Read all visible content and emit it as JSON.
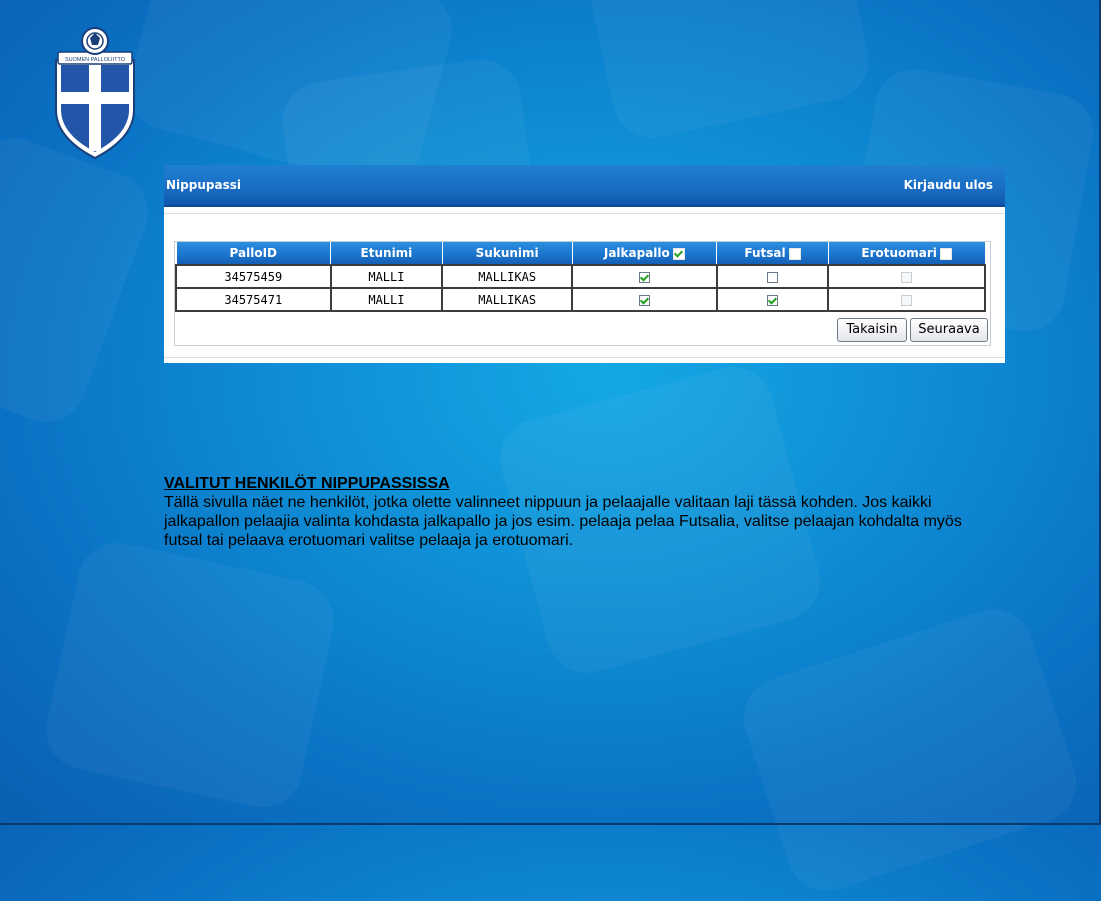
{
  "header": {
    "title": "Nippupassi",
    "logout_label": "Kirjaudu ulos"
  },
  "logo": {
    "name": "suomen-palloliitto-crest",
    "text": "SUOMEN PALLOLIITTO"
  },
  "table": {
    "columns": [
      "PalloID",
      "Etunimi",
      "Sukunimi",
      "Jalkapallo",
      "Futsal",
      "Erotuomari"
    ],
    "header_checks": {
      "jalkapallo": true,
      "futsal": false,
      "erotuomari": false
    },
    "rows": [
      {
        "pallo_id": "34575459",
        "etunimi": "MALLI",
        "sukunimi": "MALLIKAS",
        "jalkapallo": true,
        "futsal": false,
        "erotuomari": false,
        "erotuomari_disabled": true
      },
      {
        "pallo_id": "34575471",
        "etunimi": "MALLI",
        "sukunimi": "MALLIKAS",
        "jalkapallo": true,
        "futsal": true,
        "erotuomari": false,
        "erotuomari_disabled": true
      }
    ]
  },
  "buttons": {
    "back": "Takaisin",
    "next": "Seuraava"
  },
  "info": {
    "title": "VALITUT HENKILÖT NIPPUPASSISSA",
    "body": "Tällä sivulla näet ne henkilöt, jotka olette valinneet nippuun ja pelaajalle valitaan laji tässä kohden. Jos kaikki jalkapallon pelaajia valinta kohdasta jalkapallo ja jos esim. pelaaja pelaa Futsalia, valitse pelaajan kohdalta myös futsal tai pelaava erotuomari valitse pelaaja ja erotuomari."
  },
  "colors": {
    "header_blue": "#1a6ec4",
    "background_blue": "#0f8fd6",
    "check_green": "#21a121"
  }
}
